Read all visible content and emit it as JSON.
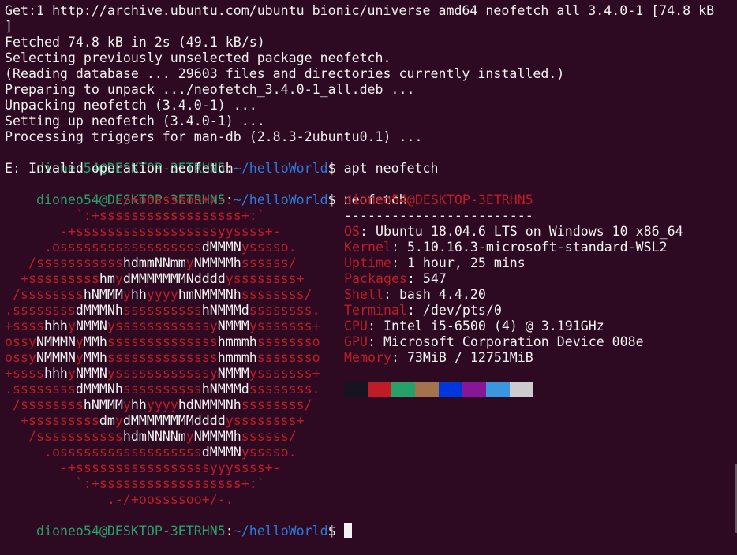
{
  "terminal": {
    "output_lines": [
      "Get:1 http://archive.ubuntu.com/ubuntu bionic/universe amd64 neofetch all 3.4.0-1 [74.8 kB",
      "]",
      "Fetched 74.8 kB in 2s (49.1 kB/s)",
      "Selecting previously unselected package neofetch.",
      "(Reading database ... 29603 files and directories currently installed.)",
      "Preparing to unpack .../neofetch_3.4.0-1_all.deb ...",
      "Unpacking neofetch (3.4.0-1) ...",
      "Setting up neofetch (3.4.0-1) ...",
      "Processing triggers for man-db (2.8.3-2ubuntu0.1) ..."
    ],
    "prompt": {
      "user_host": "dioneo54@DESKTOP-3ETRHN5",
      "sep": ":",
      "path": "~/helloWorld",
      "dollar": "$"
    },
    "cmd1": " apt neofetch",
    "error_line": "E: Invalid operation neofetch",
    "cmd2": " neofetch",
    "logo_lines": [
      "             .-/+oossssoo+/-.",
      "         `:+ssssssssssssssssss+:`",
      "       -+ssssssssssssssssssyyssss+-",
      "     .ossssssssssssssssssdMMMNysssso.",
      "   /ssssssssssshdmmNNmmyNMMMMhssssss/",
      "  +ssssssssshmydMMMMMMMNddddyssssssss+",
      " /sssssssshNMMMyhhyyyyhmNMMMNhssssssss/",
      ".ssssssssdMMMNhsssssssssshNMMMdssssssss.",
      "+sssshhhyNMMNyssssssssssssyNMMMysssssss+",
      "ossyNMMMNyMMhsssssssssssssshmmmhssssssso",
      "ossyNMMMNyMMhsssssssssssssshmmmhssssssso",
      "+sssshhhyNMMNyssssssssssssyNMMMysssssss+",
      ".ssssssssdMMMNhsssssssssshNMMMdssssssss.",
      " /sssssssshNMMMyhhyyyyhdNMMMNhssssssss/",
      "  +sssssssssdmydMMMMMMMMddddyssssssss+",
      "   /ssssssssssshdmNNNNmyNMMMMhssssss/",
      "     .ossssssssssssssssssdMMMNysssso.",
      "       -+sssssssssssssssssyyyssss+-",
      "         `:+ssssssssssssssssss+:`",
      "             .-/+oossssoo+/-."
    ],
    "info": {
      "title": "dioneo54@DESKTOP-3ETRHN5",
      "underline": "------------------------",
      "fields": [
        {
          "key": "OS",
          "value": "Ubuntu 18.04.6 LTS on Windows 10 x86_64"
        },
        {
          "key": "Kernel",
          "value": "5.10.16.3-microsoft-standard-WSL2"
        },
        {
          "key": "Uptime",
          "value": "1 hour, 25 mins"
        },
        {
          "key": "Packages",
          "value": "547"
        },
        {
          "key": "Shell",
          "value": "bash 4.4.20"
        },
        {
          "key": "Terminal",
          "value": "/dev/pts/0"
        },
        {
          "key": "CPU",
          "value": "Intel i5-6500 (4) @ 3.191GHz"
        },
        {
          "key": "GPU",
          "value": "Microsoft Corporation Device 008e"
        },
        {
          "key": "Memory",
          "value": "73MiB / 12751MiB"
        }
      ],
      "key_sep": ": "
    },
    "color_swatches": [
      "#171421",
      "#c01c28",
      "#26a269",
      "#a2734c",
      "#0037da",
      "#881798",
      "#3a96dd",
      "#cccccc"
    ],
    "colors": {
      "background": "#2d0922",
      "prompt_green": "#26a269",
      "path_blue": "#2a7bde",
      "accent_red": "#c01c28",
      "text": "#f2f2f2"
    }
  }
}
